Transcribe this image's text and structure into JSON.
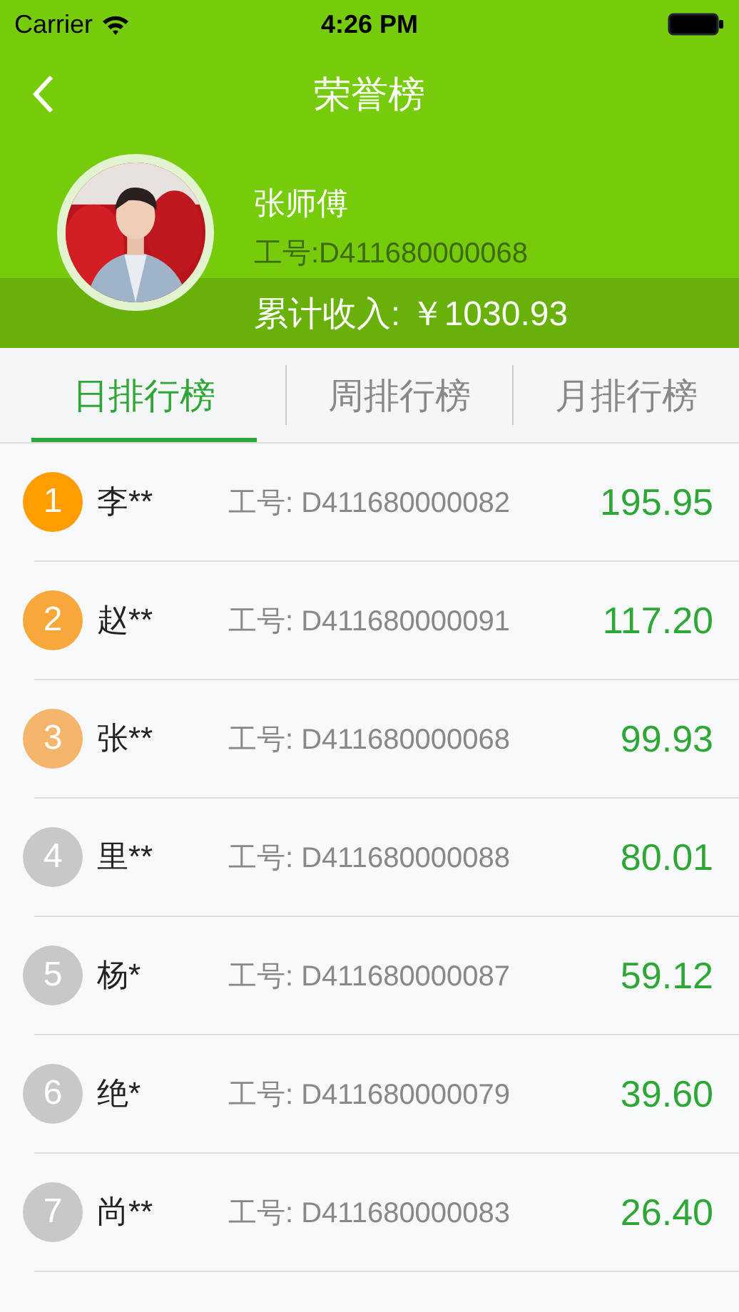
{
  "status_bar": {
    "carrier": "Carrier",
    "time": "4:26 PM"
  },
  "nav": {
    "title": "荣誉榜"
  },
  "profile": {
    "name": "张师傅",
    "id": "工号:D411680000068",
    "income": "累计收入: ￥1030.93"
  },
  "tabs": [
    {
      "label": "日排行榜",
      "selected": true
    },
    {
      "label": "周排行榜",
      "selected": false
    },
    {
      "label": "月排行榜",
      "selected": false
    }
  ],
  "rows": [
    {
      "rank": "1",
      "color": "#ff9c00",
      "name": "李**",
      "id": "工号: D411680000082",
      "amount": "195.95"
    },
    {
      "rank": "2",
      "color": "#f8a73a",
      "name": "赵**",
      "id": "工号: D411680000091",
      "amount": "117.20"
    },
    {
      "rank": "3",
      "color": "#f5b56c",
      "name": "张**",
      "id": "工号: D411680000068",
      "amount": "99.93"
    },
    {
      "rank": "4",
      "color": "#c8c8c8",
      "name": "里**",
      "id": "工号: D411680000088",
      "amount": "80.01"
    },
    {
      "rank": "5",
      "color": "#c8c8c8",
      "name": "杨*",
      "id": "工号: D411680000087",
      "amount": "59.12"
    },
    {
      "rank": "6",
      "color": "#c8c8c8",
      "name": "绝*",
      "id": "工号: D411680000079",
      "amount": "39.60"
    },
    {
      "rank": "7",
      "color": "#c8c8c8",
      "name": "尚**",
      "id": "工号: D411680000083",
      "amount": "26.40"
    }
  ]
}
